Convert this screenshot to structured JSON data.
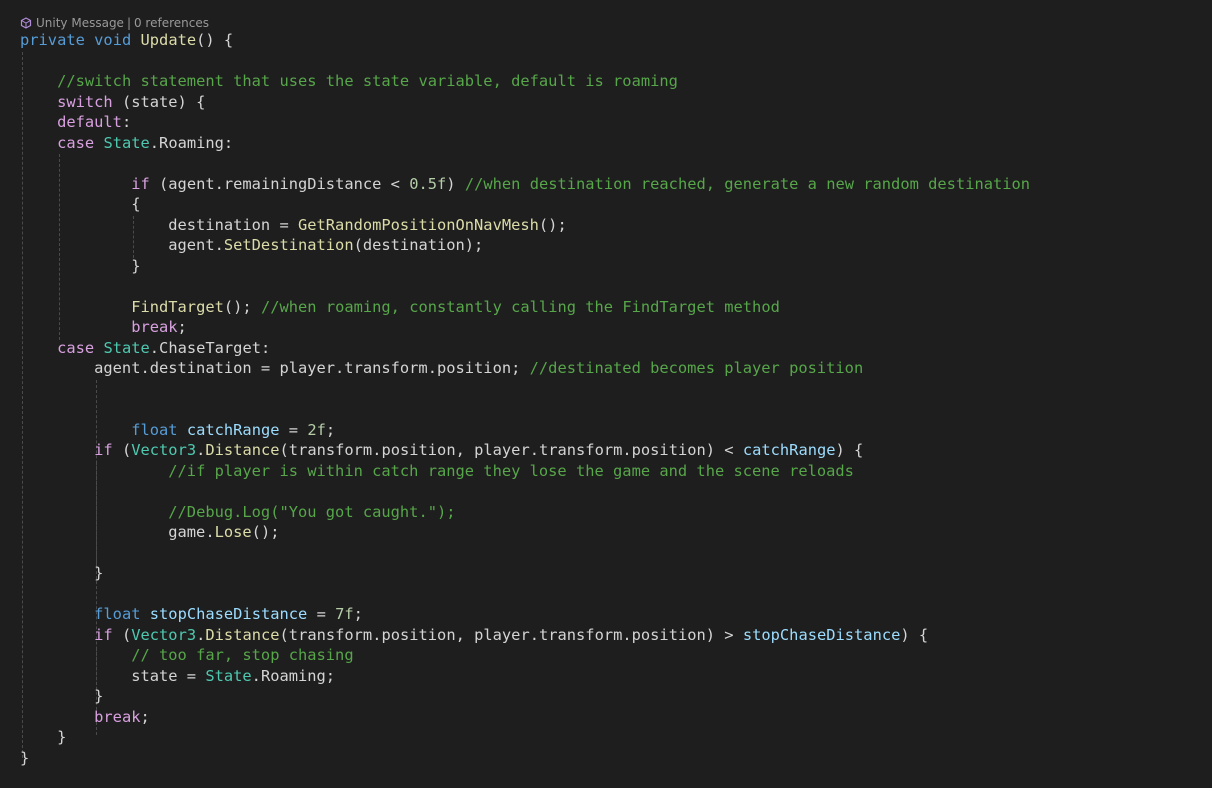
{
  "codelens": {
    "unity_label": "Unity Message",
    "separator": "|",
    "references_label": "0 references",
    "icon": "unity-cube-icon"
  },
  "colors": {
    "background": "#1e1e1e",
    "keyword": "#569cd6",
    "control": "#d8a0df",
    "type": "#4ec9b0",
    "method": "#dcdcaa",
    "comment": "#57a64a",
    "number": "#b5cea8",
    "local": "#9cdcfe",
    "plain": "#d4d4d4"
  },
  "code_lines": [
    [
      {
        "c": "kw",
        "t": "private"
      },
      {
        "c": "pl",
        "t": " "
      },
      {
        "c": "kw",
        "t": "void"
      },
      {
        "c": "pl",
        "t": " "
      },
      {
        "c": "fn",
        "t": "Update"
      },
      {
        "c": "pl",
        "t": "() {"
      }
    ],
    [],
    [
      {
        "c": "pl",
        "t": "    "
      },
      {
        "c": "cm",
        "t": "//switch statement that uses the state variable, default is roaming"
      }
    ],
    [
      {
        "c": "pl",
        "t": "    "
      },
      {
        "c": "ctl",
        "t": "switch"
      },
      {
        "c": "pl",
        "t": " (state) {"
      }
    ],
    [
      {
        "c": "pl",
        "t": "    "
      },
      {
        "c": "ctl",
        "t": "default"
      },
      {
        "c": "pl",
        "t": ":"
      }
    ],
    [
      {
        "c": "pl",
        "t": "    "
      },
      {
        "c": "ctl",
        "t": "case"
      },
      {
        "c": "pl",
        "t": " "
      },
      {
        "c": "typ",
        "t": "State"
      },
      {
        "c": "pl",
        "t": ".Roaming:"
      }
    ],
    [],
    [
      {
        "c": "pl",
        "t": "            "
      },
      {
        "c": "ctl",
        "t": "if"
      },
      {
        "c": "pl",
        "t": " (agent.remainingDistance < "
      },
      {
        "c": "num",
        "t": "0.5f"
      },
      {
        "c": "pl",
        "t": ") "
      },
      {
        "c": "cm",
        "t": "//when destination reached, generate a new random destination"
      }
    ],
    [
      {
        "c": "pl",
        "t": "            {"
      }
    ],
    [
      {
        "c": "pl",
        "t": "                destination = "
      },
      {
        "c": "fn",
        "t": "GetRandomPositionOnNavMesh"
      },
      {
        "c": "pl",
        "t": "();"
      }
    ],
    [
      {
        "c": "pl",
        "t": "                agent."
      },
      {
        "c": "fn",
        "t": "SetDestination"
      },
      {
        "c": "pl",
        "t": "(destination);"
      }
    ],
    [
      {
        "c": "pl",
        "t": "            }"
      }
    ],
    [],
    [
      {
        "c": "pl",
        "t": "            "
      },
      {
        "c": "fn",
        "t": "FindTarget"
      },
      {
        "c": "pl",
        "t": "(); "
      },
      {
        "c": "cm",
        "t": "//when roaming, constantly calling the FindTarget method"
      }
    ],
    [
      {
        "c": "pl",
        "t": "            "
      },
      {
        "c": "ctl",
        "t": "break"
      },
      {
        "c": "pl",
        "t": ";"
      }
    ],
    [
      {
        "c": "pl",
        "t": "    "
      },
      {
        "c": "ctl",
        "t": "case"
      },
      {
        "c": "pl",
        "t": " "
      },
      {
        "c": "typ",
        "t": "State"
      },
      {
        "c": "pl",
        "t": ".ChaseTarget:"
      }
    ],
    [
      {
        "c": "pl",
        "t": "        agent.destination = player.transform.position; "
      },
      {
        "c": "cm",
        "t": "//destinated becomes player position"
      }
    ],
    [],
    [],
    [
      {
        "c": "pl",
        "t": "            "
      },
      {
        "c": "kw",
        "t": "float"
      },
      {
        "c": "pl",
        "t": " "
      },
      {
        "c": "loc",
        "t": "catchRange"
      },
      {
        "c": "pl",
        "t": " = "
      },
      {
        "c": "num",
        "t": "2f"
      },
      {
        "c": "pl",
        "t": ";"
      }
    ],
    [
      {
        "c": "pl",
        "t": "        "
      },
      {
        "c": "ctl",
        "t": "if"
      },
      {
        "c": "pl",
        "t": " ("
      },
      {
        "c": "typ",
        "t": "Vector3"
      },
      {
        "c": "pl",
        "t": "."
      },
      {
        "c": "fn",
        "t": "Distance"
      },
      {
        "c": "pl",
        "t": "(transform.position, player.transform.position) < "
      },
      {
        "c": "loc",
        "t": "catchRange"
      },
      {
        "c": "pl",
        "t": ") {"
      }
    ],
    [
      {
        "c": "pl",
        "t": "                "
      },
      {
        "c": "cm",
        "t": "//if player is within catch range they lose the game and the scene reloads"
      }
    ],
    [],
    [
      {
        "c": "pl",
        "t": "                "
      },
      {
        "c": "cm",
        "t": "//Debug.Log(\"You got caught.\");"
      }
    ],
    [
      {
        "c": "pl",
        "t": "                game."
      },
      {
        "c": "fn",
        "t": "Lose"
      },
      {
        "c": "pl",
        "t": "();"
      }
    ],
    [],
    [
      {
        "c": "pl",
        "t": "        }"
      }
    ],
    [],
    [
      {
        "c": "pl",
        "t": "        "
      },
      {
        "c": "kw",
        "t": "float"
      },
      {
        "c": "pl",
        "t": " "
      },
      {
        "c": "loc",
        "t": "stopChaseDistance"
      },
      {
        "c": "pl",
        "t": " = "
      },
      {
        "c": "num",
        "t": "7f"
      },
      {
        "c": "pl",
        "t": ";"
      }
    ],
    [
      {
        "c": "pl",
        "t": "        "
      },
      {
        "c": "ctl",
        "t": "if"
      },
      {
        "c": "pl",
        "t": " ("
      },
      {
        "c": "typ",
        "t": "Vector3"
      },
      {
        "c": "pl",
        "t": "."
      },
      {
        "c": "fn",
        "t": "Distance"
      },
      {
        "c": "pl",
        "t": "(transform.position, player.transform.position) > "
      },
      {
        "c": "loc",
        "t": "stopChaseDistance"
      },
      {
        "c": "pl",
        "t": ") {"
      }
    ],
    [
      {
        "c": "pl",
        "t": "            "
      },
      {
        "c": "cm",
        "t": "// too far, stop chasing"
      }
    ],
    [
      {
        "c": "pl",
        "t": "            state = "
      },
      {
        "c": "typ",
        "t": "State"
      },
      {
        "c": "pl",
        "t": ".Roaming;"
      }
    ],
    [
      {
        "c": "pl",
        "t": "        }"
      }
    ],
    [
      {
        "c": "pl",
        "t": "        "
      },
      {
        "c": "ctl",
        "t": "break"
      },
      {
        "c": "pl",
        "t": ";"
      }
    ],
    [
      {
        "c": "pl",
        "t": "    }"
      }
    ],
    [
      {
        "c": "pl",
        "t": "}"
      }
    ]
  ]
}
